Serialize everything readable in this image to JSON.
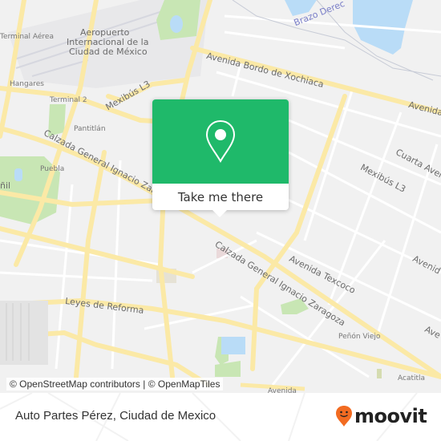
{
  "map": {
    "labels": {
      "terminal_aerea": "Terminal Aérea",
      "aeropuerto_1": "Aeropuerto",
      "aeropuerto_2": "Internacional de la",
      "aeropuerto_3": "Ciudad de México",
      "hangares": "Hangares",
      "terminal_2": "Terminal 2",
      "mexibus_l3_west": "Mexibús L3",
      "pantitlan": "Pantitlán",
      "calzada_west": "Calzada General Ignacio Zarag",
      "puebla": "Puebla",
      "nil": "ñil",
      "brazo_derecho": "Brazo Derec",
      "avenida_bordo": "Avenida Bordo de Xochiaca",
      "avenida_east": "Avenida",
      "cuarta_avenida": "Cuarta Aven",
      "mexibus_l3_east": "Mexibús L3",
      "calzada_east": "Calzada General Ignacio Zaragoza",
      "avenida_texcoco": "Avenida Texcoco",
      "avenida_east2": "Avenid",
      "avenida_east3": "Ave",
      "leyes_de_reforma": "Leyes de Reforma",
      "penon_viejo": "Peñón Viejo",
      "acatitla": "Acatitla",
      "avenida_south": "Avenida"
    },
    "attribution": "© OpenStreetMap contributors | © OpenMapTiles",
    "colors": {
      "land": "#f1f1f1",
      "major_road": "#fbe9a6",
      "minor_road": "#ffffff",
      "park": "#c8e6b4",
      "water": "#b9dcf7"
    }
  },
  "popup": {
    "icon": "map-pin-icon",
    "action_label": "Take me there",
    "color": "#1fb96a"
  },
  "footer": {
    "place_name": "Auto Partes Pérez, Ciudad de Mexico",
    "brand": "moovit",
    "brand_icon": "moovit-pin-smile-icon",
    "brand_color": "#f26b21"
  }
}
